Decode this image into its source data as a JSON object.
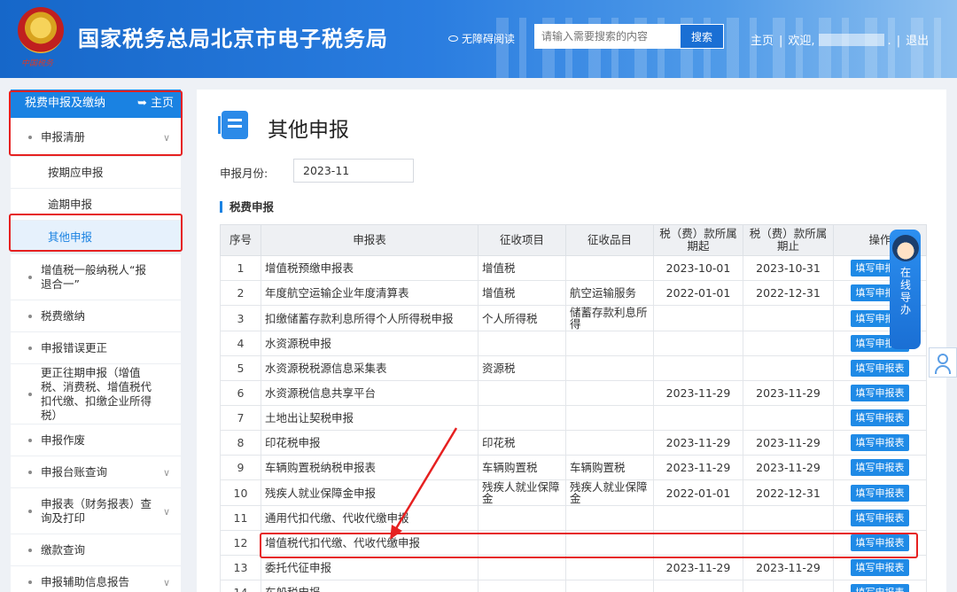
{
  "header": {
    "title": "国家税务总局北京市电子税务局",
    "emblem_caption": "中国税务",
    "accessibility": "无障碍阅读",
    "search_placeholder": "请输入需要搜索的内容",
    "search_button": "搜索",
    "home": "主页",
    "welcome": "欢迎,",
    "logout": "退出"
  },
  "sidebar": {
    "header": "税费申报及缴纳",
    "home_link": "主页",
    "items": [
      {
        "label": "申报清册",
        "type": "group",
        "chevron": true
      },
      {
        "label": "按期应申报",
        "type": "sub"
      },
      {
        "label": "逾期申报",
        "type": "sub"
      },
      {
        "label": "其他申报",
        "type": "sub",
        "active": true
      },
      {
        "label": "增值税一般纳税人“报退合一”",
        "type": "item"
      },
      {
        "label": "税费缴纳",
        "type": "item"
      },
      {
        "label": "申报错误更正",
        "type": "item"
      },
      {
        "label": "更正往期申报（增值税、消费税、增值税代扣代缴、扣缴企业所得税）",
        "type": "item"
      },
      {
        "label": "申报作废",
        "type": "item"
      },
      {
        "label": "申报台账查询",
        "type": "item",
        "chevron": true
      },
      {
        "label": "申报表（财务报表）查询及打印",
        "type": "item",
        "chevron": true
      },
      {
        "label": "缴款查询",
        "type": "item"
      },
      {
        "label": "申报辅助信息报告",
        "type": "item",
        "chevron": true
      }
    ]
  },
  "main": {
    "title": "其他申报",
    "month_label": "申报月份:",
    "month_value": "2023-11",
    "section_title": "税费申报",
    "columns": [
      "序号",
      "申报表",
      "征收项目",
      "征收品目",
      "税（费）款所属期起",
      "税（费）款所属期止",
      "操作"
    ],
    "action_label": "填写申报表",
    "rows": [
      {
        "seq": "1",
        "form": "增值税预缴申报表",
        "item": "增值税",
        "subitem": "",
        "start": "2023-10-01",
        "end": "2023-10-31"
      },
      {
        "seq": "2",
        "form": "年度航空运输企业年度清算表",
        "item": "增值税",
        "subitem": "航空运输服务",
        "start": "2022-01-01",
        "end": "2022-12-31"
      },
      {
        "seq": "3",
        "form": "扣缴储蓄存款利息所得个人所得税申报",
        "item": "个人所得税",
        "subitem": "储蓄存款利息所得",
        "start": "",
        "end": ""
      },
      {
        "seq": "4",
        "form": "水资源税申报",
        "item": "",
        "subitem": "",
        "start": "",
        "end": ""
      },
      {
        "seq": "5",
        "form": "水资源税税源信息采集表",
        "item": "资源税",
        "subitem": "",
        "start": "",
        "end": ""
      },
      {
        "seq": "6",
        "form": "水资源税信息共享平台",
        "item": "",
        "subitem": "",
        "start": "2023-11-29",
        "end": "2023-11-29"
      },
      {
        "seq": "7",
        "form": "土地出让契税申报",
        "item": "",
        "subitem": "",
        "start": "",
        "end": ""
      },
      {
        "seq": "8",
        "form": "印花税申报",
        "item": "印花税",
        "subitem": "",
        "start": "2023-11-29",
        "end": "2023-11-29"
      },
      {
        "seq": "9",
        "form": "车辆购置税纳税申报表",
        "item": "车辆购置税",
        "subitem": "车辆购置税",
        "start": "2023-11-29",
        "end": "2023-11-29"
      },
      {
        "seq": "10",
        "form": "残疾人就业保障金申报",
        "item": "残疾人就业保障金",
        "subitem": "残疾人就业保障金",
        "start": "2022-01-01",
        "end": "2022-12-31"
      },
      {
        "seq": "11",
        "form": "通用代扣代缴、代收代缴申报",
        "item": "",
        "subitem": "",
        "start": "",
        "end": ""
      },
      {
        "seq": "12",
        "form": "增值税代扣代缴、代收代缴申报",
        "item": "",
        "subitem": "",
        "start": "",
        "end": ""
      },
      {
        "seq": "13",
        "form": "委托代征申报",
        "item": "",
        "subitem": "",
        "start": "2023-11-29",
        "end": "2023-11-29"
      },
      {
        "seq": "14",
        "form": "车船税申报",
        "item": "",
        "subitem": "",
        "start": "",
        "end": ""
      }
    ]
  },
  "assistant": {
    "label": "在线导办"
  },
  "colors": {
    "brand_blue": "#1a82e2",
    "highlight_red": "#e62020"
  }
}
